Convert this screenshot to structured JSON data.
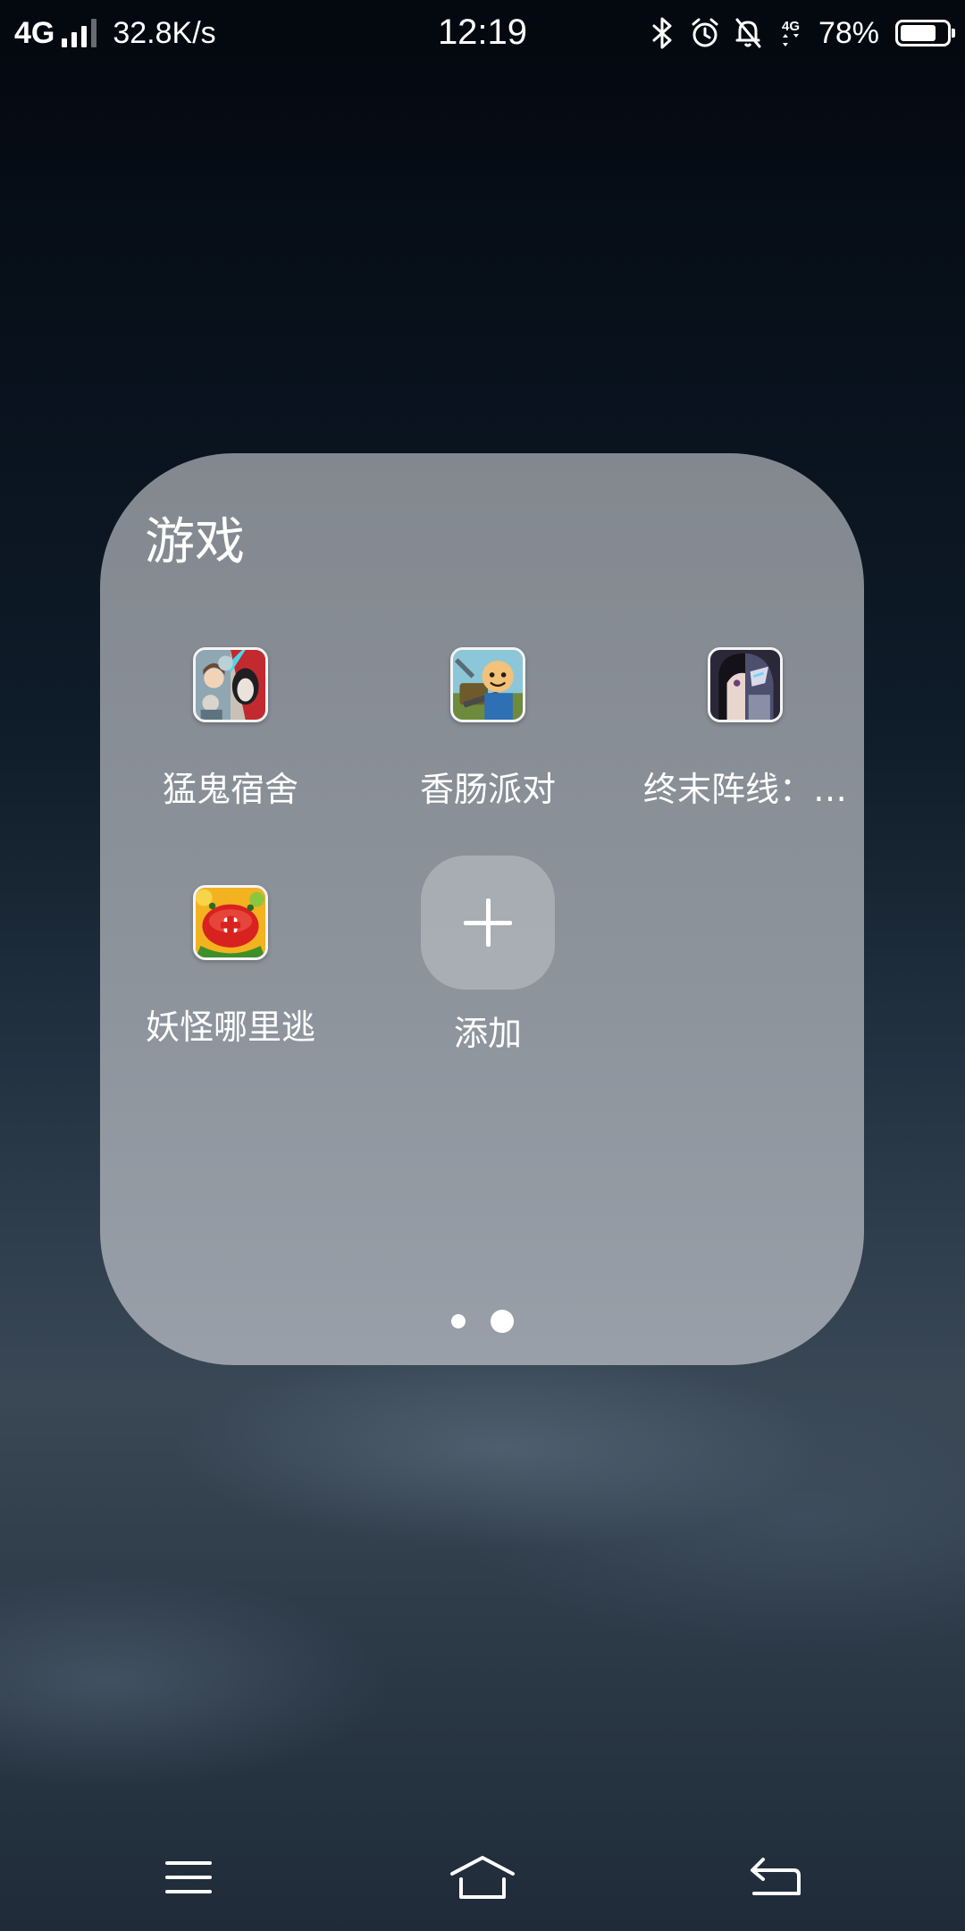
{
  "status_bar": {
    "network": "4G",
    "speed": "32.8K/s",
    "time": "12:19",
    "battery_percent": "78%",
    "battery_level": 0.78,
    "icons": [
      "signal-icon",
      "bluetooth-icon",
      "alarm-icon",
      "mute-bell-icon",
      "data-4g-icon",
      "battery-icon"
    ]
  },
  "folder": {
    "title": "游戏",
    "apps": [
      {
        "label": "猛鬼宿舍",
        "icon": "ghost-dorm-game-icon"
      },
      {
        "label": "香肠派对",
        "icon": "sausage-party-game-icon"
      },
      {
        "label": "终末阵线：…",
        "icon": "final-front-game-icon"
      },
      {
        "label": "妖怪哪里逃",
        "icon": "monster-escape-game-icon"
      }
    ],
    "add_label": "添加",
    "pages": {
      "count": 2,
      "current": 2
    }
  },
  "nav_bar": {
    "icons": [
      "menu-icon",
      "home-icon",
      "back-icon"
    ]
  },
  "colors": {
    "folder_bg": "#8b9097",
    "text": "#ffffff"
  }
}
